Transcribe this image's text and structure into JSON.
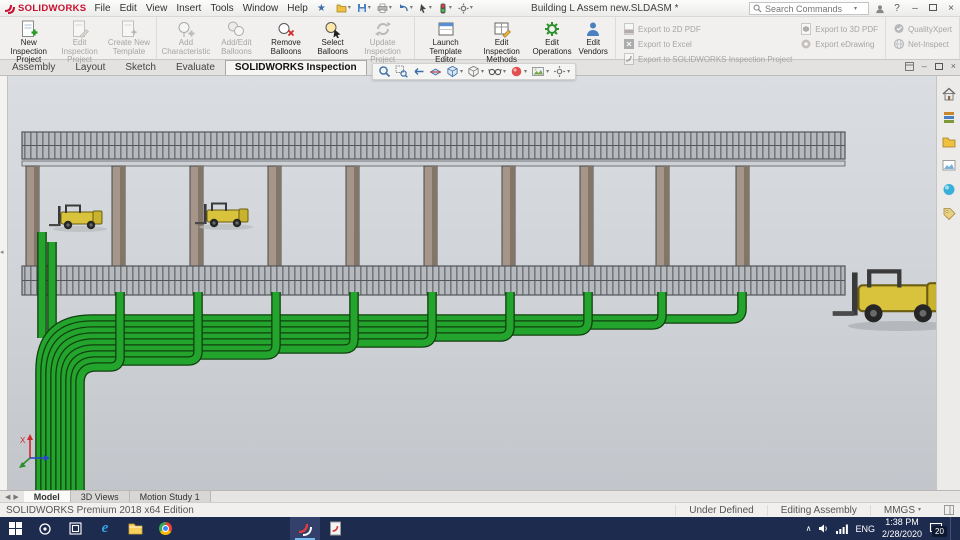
{
  "colors": {
    "pipe_green": "#23a42c",
    "pipe_outline": "#11400f",
    "forklift_yellow": "#d9c33c",
    "structure_gray": "#b6b9bd",
    "column_tan": "#a59689",
    "taskbar_navy": "#1d2b4e",
    "solidworks_red": "#c8102e",
    "viewport_gradient_top": "#dadde1",
    "viewport_gradient_bottom": "#c2c6cb"
  },
  "titlebar": {
    "logo_text": "SOLIDWORKS",
    "menus": [
      "File",
      "Edit",
      "View",
      "Insert",
      "Tools",
      "Window",
      "Help"
    ],
    "document_title": "Building L Assem new.SLDASM *",
    "search_placeholder": "Search Commands",
    "window_controls": {
      "help": "?",
      "minimize": "–",
      "close": "×"
    }
  },
  "ribbon": {
    "buttons": [
      {
        "label": "New Inspection Project",
        "enabled": true
      },
      {
        "label": "Edit Inspection Project",
        "enabled": false
      },
      {
        "label": "Create New Template",
        "enabled": false
      },
      {
        "label": "Add Characteristic",
        "enabled": false
      },
      {
        "label": "Add/Edit Balloons",
        "enabled": false
      },
      {
        "label": "Remove Balloons",
        "enabled": true
      },
      {
        "label": "Select Balloons",
        "enabled": true
      },
      {
        "label": "Update Inspection Project",
        "enabled": false
      },
      {
        "label": "Launch Template Editor",
        "enabled": true
      },
      {
        "label": "Edit Inspection Methods",
        "enabled": true
      },
      {
        "label": "Edit Operations",
        "enabled": true
      },
      {
        "label": "Edit Vendors",
        "enabled": true
      },
      {
        "label": "Export to 2D PDF",
        "enabled": false
      },
      {
        "label": "Export to Excel",
        "enabled": false
      },
      {
        "label": "Export to SOLIDWORKS Inspection Project",
        "enabled": false
      },
      {
        "label": "Export to 3D PDF",
        "enabled": false
      },
      {
        "label": "Export eDrawing",
        "enabled": false
      },
      {
        "label": "QualityXpert",
        "enabled": false
      },
      {
        "label": "Net-Inspect",
        "enabled": false
      }
    ]
  },
  "command_tabs": {
    "items": [
      {
        "label": "Assembly",
        "active": false
      },
      {
        "label": "Layout",
        "active": false
      },
      {
        "label": "Sketch",
        "active": false
      },
      {
        "label": "Evaluate",
        "active": false
      },
      {
        "label": "SOLIDWORKS Inspection",
        "active": true
      }
    ]
  },
  "headsup_tools": [
    "zoom-to-fit",
    "zoom-to-area",
    "previous-view",
    "section-view",
    "view-orientation",
    "display-style",
    "hide-show-items",
    "edit-appearance",
    "apply-scene",
    "view-settings"
  ],
  "viewport": {
    "triad": {
      "x_label": "X"
    }
  },
  "taskpane_tabs": [
    "solidworks-resources",
    "design-library",
    "file-explorer",
    "view-palette",
    "appearances-scenes",
    "custom-properties"
  ],
  "model_tabs": {
    "items": [
      {
        "label": "Model",
        "active": true
      },
      {
        "label": "3D Views",
        "active": false
      },
      {
        "label": "Motion Study 1",
        "active": false
      }
    ]
  },
  "statusbar": {
    "edition": "SOLIDWORKS Premium 2018 x64 Edition",
    "state": "Under Defined",
    "mode": "Editing Assembly",
    "units": "MMGS"
  },
  "taskbar": {
    "tray": {
      "language": "ENG",
      "time": "1:38 PM",
      "date": "2/28/2020",
      "notification_count": "20"
    }
  }
}
